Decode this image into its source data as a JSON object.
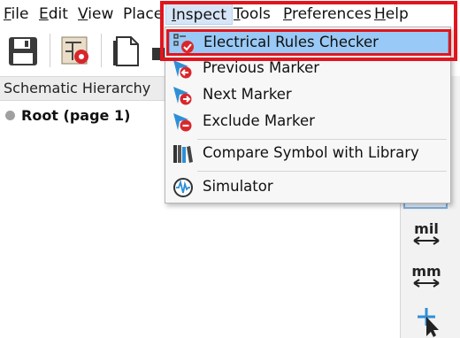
{
  "menubar": {
    "items": [
      {
        "label": "File",
        "accel": "F",
        "rest": "ile"
      },
      {
        "label": "Edit",
        "accel": "E",
        "rest": "dit"
      },
      {
        "label": "View",
        "accel": "V",
        "rest": "iew"
      },
      {
        "label": "Place",
        "accel": "",
        "rest": "Place"
      },
      {
        "label": "Inspect",
        "accel": "I",
        "rest": "nspect"
      },
      {
        "label": "Tools",
        "accel": "T",
        "rest": "ools"
      },
      {
        "label": "Preferences",
        "accel": "P",
        "rest": "references"
      },
      {
        "label": "Help",
        "accel": "H",
        "rest": "elp"
      }
    ]
  },
  "toolbar": {
    "icons": [
      "save-icon",
      "schematic-setup-icon",
      "page-settings-icon",
      "print-icon"
    ]
  },
  "hierarchy": {
    "title": "Schematic Hierarchy",
    "root": "Root (page 1)"
  },
  "inspect_menu": {
    "items": [
      {
        "label": "Electrical Rules Checker",
        "icon": "erc-icon",
        "selected": true
      },
      {
        "label": "Previous Marker",
        "icon": "previous-marker-icon",
        "selected": false
      },
      {
        "label": "Next Marker",
        "icon": "next-marker-icon",
        "selected": false
      },
      {
        "label": "Exclude Marker",
        "icon": "exclude-marker-icon",
        "selected": false
      },
      {
        "label": "Compare Symbol with Library",
        "icon": "compare-library-icon",
        "selected": false
      },
      {
        "label": "Simulator",
        "icon": "simulator-icon",
        "selected": false
      }
    ]
  },
  "right_toolbar": {
    "mil": "mil",
    "mm": "mm"
  },
  "colors": {
    "highlight": "#e0161e",
    "selected_item": "#99c9f6",
    "menu_active": "#d7e6f7",
    "marker_red": "#d9262b",
    "marker_blue": "#2f8fd6"
  }
}
